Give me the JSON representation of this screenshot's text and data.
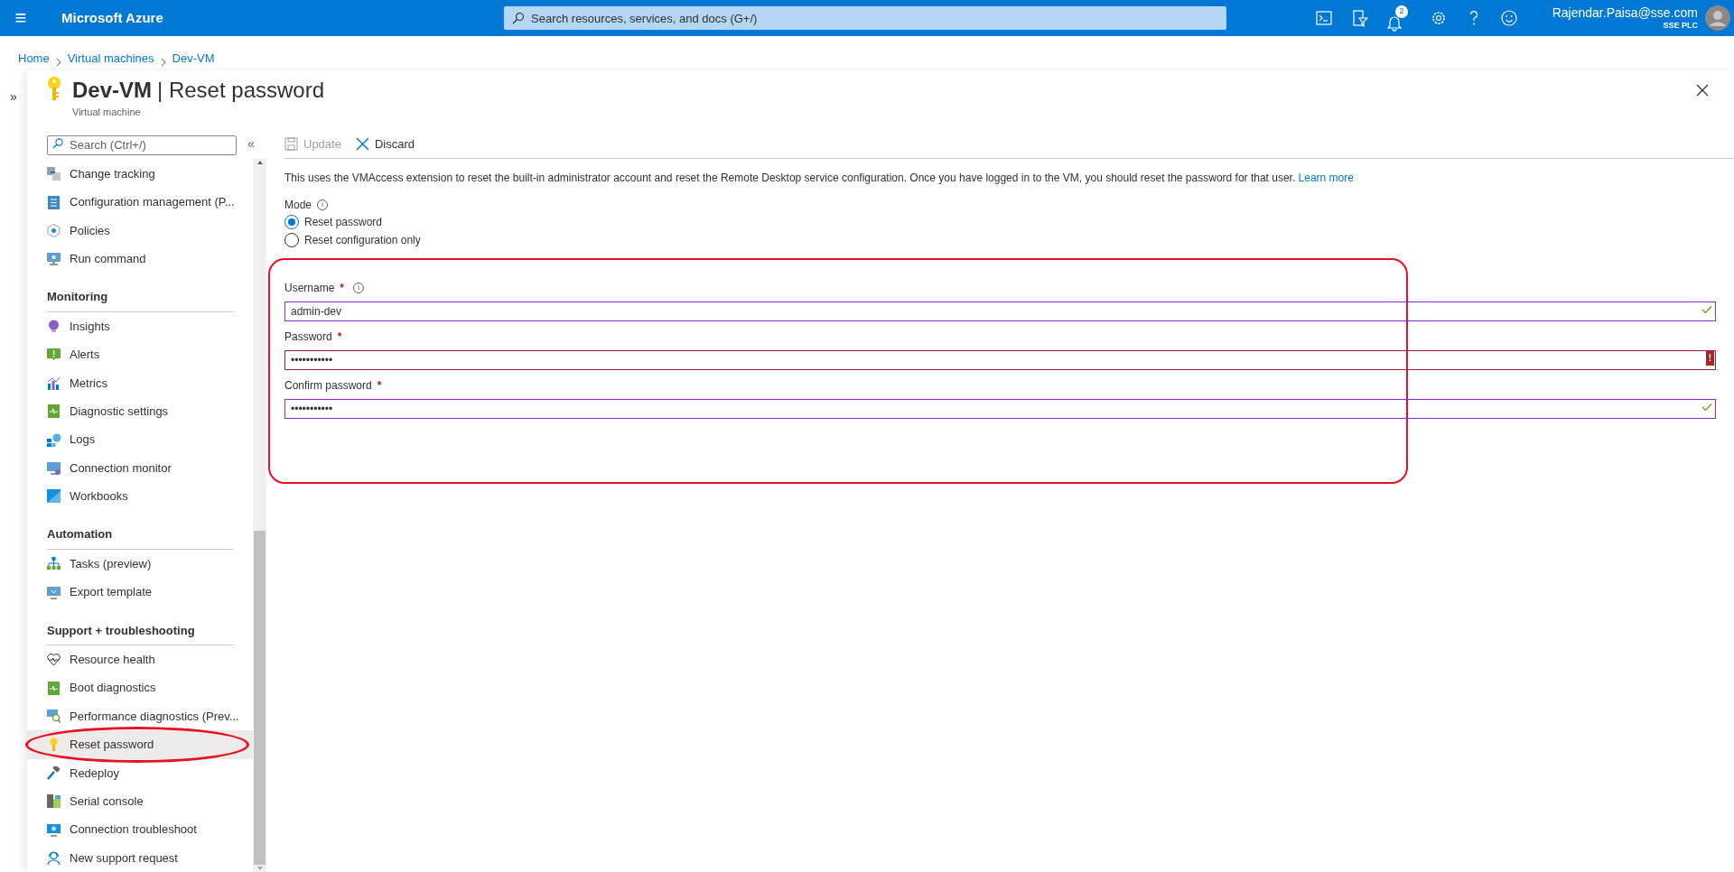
{
  "top_bar": {
    "menu_icon": "≡",
    "brand": "Microsoft Azure",
    "search": {
      "placeholder": "Search resources, services, and docs (G+/)"
    },
    "notification_count": "2",
    "user": {
      "email": "Rajendar.Paisa@sse.com",
      "org": "SSE PLC"
    }
  },
  "breadcrumb": [
    "Home",
    "Virtual machines",
    "Dev-VM"
  ],
  "blade": {
    "title_bold": "Dev-VM",
    "title_rest": "| Reset password",
    "subtitle": "Virtual machine",
    "expand_glyph": "»",
    "collapse_glyph": "«"
  },
  "sidebar": {
    "search": {
      "placeholder": "Search (Ctrl+/)"
    },
    "items": [
      {
        "kind": "item",
        "label": "Change tracking",
        "selected": false,
        "highlighted": false
      },
      {
        "kind": "item",
        "label": "Configuration management (P...",
        "selected": false,
        "highlighted": false
      },
      {
        "kind": "item",
        "label": "Policies",
        "selected": false,
        "highlighted": false
      },
      {
        "kind": "item",
        "label": "Run command",
        "selected": false,
        "highlighted": false
      },
      {
        "kind": "header",
        "label": "Monitoring"
      },
      {
        "kind": "item",
        "label": "Insights",
        "selected": false,
        "highlighted": false
      },
      {
        "kind": "item",
        "label": "Alerts",
        "selected": false,
        "highlighted": false
      },
      {
        "kind": "item",
        "label": "Metrics",
        "selected": false,
        "highlighted": false
      },
      {
        "kind": "item",
        "label": "Diagnostic settings",
        "selected": false,
        "highlighted": false
      },
      {
        "kind": "item",
        "label": "Logs",
        "selected": false,
        "highlighted": false
      },
      {
        "kind": "item",
        "label": "Connection monitor",
        "selected": false,
        "highlighted": false
      },
      {
        "kind": "item",
        "label": "Workbooks",
        "selected": false,
        "highlighted": false
      },
      {
        "kind": "header",
        "label": "Automation"
      },
      {
        "kind": "item",
        "label": "Tasks (preview)",
        "selected": false,
        "highlighted": false
      },
      {
        "kind": "item",
        "label": "Export template",
        "selected": false,
        "highlighted": false
      },
      {
        "kind": "header",
        "label": "Support + troubleshooting"
      },
      {
        "kind": "item",
        "label": "Resource health",
        "selected": false,
        "highlighted": false
      },
      {
        "kind": "item",
        "label": "Boot diagnostics",
        "selected": false,
        "highlighted": false
      },
      {
        "kind": "item",
        "label": "Performance diagnostics (Prev...",
        "selected": false,
        "highlighted": false
      },
      {
        "kind": "item",
        "label": "Reset password",
        "selected": true,
        "highlighted": true
      },
      {
        "kind": "item",
        "label": "Redeploy",
        "selected": false,
        "highlighted": false
      },
      {
        "kind": "item",
        "label": "Serial console",
        "selected": false,
        "highlighted": false
      },
      {
        "kind": "item",
        "label": "Connection troubleshoot",
        "selected": false,
        "highlighted": false
      },
      {
        "kind": "item",
        "label": "New support request",
        "selected": false,
        "highlighted": false
      }
    ]
  },
  "toolbar": [
    {
      "label": "Update",
      "disabled": true
    },
    {
      "label": "Discard",
      "disabled": false
    }
  ],
  "description": "This uses the VMAccess extension to reset the built-in administrator account and reset the Remote Desktop service configuration. Once you have logged in to the VM, you should reset the password for that user.",
  "learn_more": "Learn more",
  "mode": {
    "label": "Mode",
    "info_glyph": "i",
    "options": [
      {
        "label": "Reset password",
        "selected": true
      },
      {
        "label": "Reset configuration only",
        "selected": false
      }
    ]
  },
  "credentials": {
    "highlighted": true,
    "fields": [
      {
        "label": "Username",
        "required": true,
        "info_glyph": "i",
        "value": "admin-dev",
        "valid": true
      },
      {
        "label": "Password",
        "required": true,
        "value": "•••••••••••",
        "valid": false,
        "error_glyph": "!"
      },
      {
        "label": "Confirm password",
        "required": true,
        "value": "•••••••••••",
        "valid": true
      }
    ]
  },
  "required_mark": "*"
}
